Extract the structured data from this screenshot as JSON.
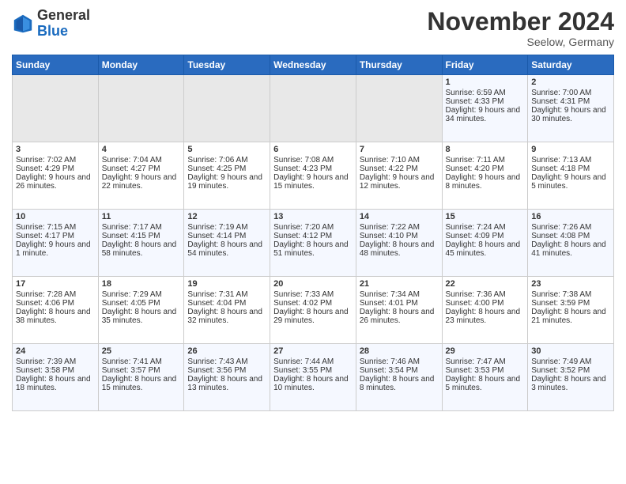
{
  "logo": {
    "general": "General",
    "blue": "Blue"
  },
  "header": {
    "month": "November 2024",
    "location": "Seelow, Germany"
  },
  "weekdays": [
    "Sunday",
    "Monday",
    "Tuesday",
    "Wednesday",
    "Thursday",
    "Friday",
    "Saturday"
  ],
  "weeks": [
    [
      {
        "day": "",
        "empty": true
      },
      {
        "day": "",
        "empty": true
      },
      {
        "day": "",
        "empty": true
      },
      {
        "day": "",
        "empty": true
      },
      {
        "day": "",
        "empty": true
      },
      {
        "day": "1",
        "sunrise": "Sunrise: 6:59 AM",
        "sunset": "Sunset: 4:33 PM",
        "daylight": "Daylight: 9 hours and 34 minutes."
      },
      {
        "day": "2",
        "sunrise": "Sunrise: 7:00 AM",
        "sunset": "Sunset: 4:31 PM",
        "daylight": "Daylight: 9 hours and 30 minutes."
      }
    ],
    [
      {
        "day": "3",
        "sunrise": "Sunrise: 7:02 AM",
        "sunset": "Sunset: 4:29 PM",
        "daylight": "Daylight: 9 hours and 26 minutes."
      },
      {
        "day": "4",
        "sunrise": "Sunrise: 7:04 AM",
        "sunset": "Sunset: 4:27 PM",
        "daylight": "Daylight: 9 hours and 22 minutes."
      },
      {
        "day": "5",
        "sunrise": "Sunrise: 7:06 AM",
        "sunset": "Sunset: 4:25 PM",
        "daylight": "Daylight: 9 hours and 19 minutes."
      },
      {
        "day": "6",
        "sunrise": "Sunrise: 7:08 AM",
        "sunset": "Sunset: 4:23 PM",
        "daylight": "Daylight: 9 hours and 15 minutes."
      },
      {
        "day": "7",
        "sunrise": "Sunrise: 7:10 AM",
        "sunset": "Sunset: 4:22 PM",
        "daylight": "Daylight: 9 hours and 12 minutes."
      },
      {
        "day": "8",
        "sunrise": "Sunrise: 7:11 AM",
        "sunset": "Sunset: 4:20 PM",
        "daylight": "Daylight: 9 hours and 8 minutes."
      },
      {
        "day": "9",
        "sunrise": "Sunrise: 7:13 AM",
        "sunset": "Sunset: 4:18 PM",
        "daylight": "Daylight: 9 hours and 5 minutes."
      }
    ],
    [
      {
        "day": "10",
        "sunrise": "Sunrise: 7:15 AM",
        "sunset": "Sunset: 4:17 PM",
        "daylight": "Daylight: 9 hours and 1 minute."
      },
      {
        "day": "11",
        "sunrise": "Sunrise: 7:17 AM",
        "sunset": "Sunset: 4:15 PM",
        "daylight": "Daylight: 8 hours and 58 minutes."
      },
      {
        "day": "12",
        "sunrise": "Sunrise: 7:19 AM",
        "sunset": "Sunset: 4:14 PM",
        "daylight": "Daylight: 8 hours and 54 minutes."
      },
      {
        "day": "13",
        "sunrise": "Sunrise: 7:20 AM",
        "sunset": "Sunset: 4:12 PM",
        "daylight": "Daylight: 8 hours and 51 minutes."
      },
      {
        "day": "14",
        "sunrise": "Sunrise: 7:22 AM",
        "sunset": "Sunset: 4:10 PM",
        "daylight": "Daylight: 8 hours and 48 minutes."
      },
      {
        "day": "15",
        "sunrise": "Sunrise: 7:24 AM",
        "sunset": "Sunset: 4:09 PM",
        "daylight": "Daylight: 8 hours and 45 minutes."
      },
      {
        "day": "16",
        "sunrise": "Sunrise: 7:26 AM",
        "sunset": "Sunset: 4:08 PM",
        "daylight": "Daylight: 8 hours and 41 minutes."
      }
    ],
    [
      {
        "day": "17",
        "sunrise": "Sunrise: 7:28 AM",
        "sunset": "Sunset: 4:06 PM",
        "daylight": "Daylight: 8 hours and 38 minutes."
      },
      {
        "day": "18",
        "sunrise": "Sunrise: 7:29 AM",
        "sunset": "Sunset: 4:05 PM",
        "daylight": "Daylight: 8 hours and 35 minutes."
      },
      {
        "day": "19",
        "sunrise": "Sunrise: 7:31 AM",
        "sunset": "Sunset: 4:04 PM",
        "daylight": "Daylight: 8 hours and 32 minutes."
      },
      {
        "day": "20",
        "sunrise": "Sunrise: 7:33 AM",
        "sunset": "Sunset: 4:02 PM",
        "daylight": "Daylight: 8 hours and 29 minutes."
      },
      {
        "day": "21",
        "sunrise": "Sunrise: 7:34 AM",
        "sunset": "Sunset: 4:01 PM",
        "daylight": "Daylight: 8 hours and 26 minutes."
      },
      {
        "day": "22",
        "sunrise": "Sunrise: 7:36 AM",
        "sunset": "Sunset: 4:00 PM",
        "daylight": "Daylight: 8 hours and 23 minutes."
      },
      {
        "day": "23",
        "sunrise": "Sunrise: 7:38 AM",
        "sunset": "Sunset: 3:59 PM",
        "daylight": "Daylight: 8 hours and 21 minutes."
      }
    ],
    [
      {
        "day": "24",
        "sunrise": "Sunrise: 7:39 AM",
        "sunset": "Sunset: 3:58 PM",
        "daylight": "Daylight: 8 hours and 18 minutes."
      },
      {
        "day": "25",
        "sunrise": "Sunrise: 7:41 AM",
        "sunset": "Sunset: 3:57 PM",
        "daylight": "Daylight: 8 hours and 15 minutes."
      },
      {
        "day": "26",
        "sunrise": "Sunrise: 7:43 AM",
        "sunset": "Sunset: 3:56 PM",
        "daylight": "Daylight: 8 hours and 13 minutes."
      },
      {
        "day": "27",
        "sunrise": "Sunrise: 7:44 AM",
        "sunset": "Sunset: 3:55 PM",
        "daylight": "Daylight: 8 hours and 10 minutes."
      },
      {
        "day": "28",
        "sunrise": "Sunrise: 7:46 AM",
        "sunset": "Sunset: 3:54 PM",
        "daylight": "Daylight: 8 hours and 8 minutes."
      },
      {
        "day": "29",
        "sunrise": "Sunrise: 7:47 AM",
        "sunset": "Sunset: 3:53 PM",
        "daylight": "Daylight: 8 hours and 5 minutes."
      },
      {
        "day": "30",
        "sunrise": "Sunrise: 7:49 AM",
        "sunset": "Sunset: 3:52 PM",
        "daylight": "Daylight: 8 hours and 3 minutes."
      }
    ]
  ]
}
